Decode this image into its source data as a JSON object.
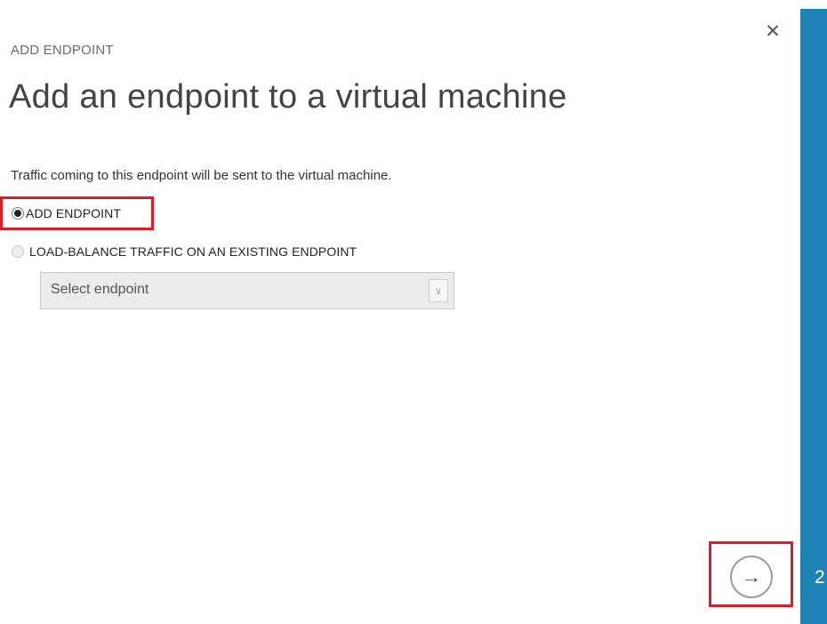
{
  "dialog": {
    "subtitle": "ADD ENDPOINT",
    "title": "Add an endpoint to a virtual machine",
    "description": "Traffic coming to this endpoint will be sent to the virtual machine.",
    "options": {
      "add_endpoint": {
        "label": "ADD ENDPOINT",
        "selected": true
      },
      "load_balance": {
        "label": "LOAD-BALANCE TRAFFIC ON AN EXISTING ENDPOINT",
        "selected": false
      }
    },
    "endpoint_select": {
      "placeholder": "Select endpoint"
    },
    "close_icon": "close-icon",
    "next_icon": "arrow-right-icon"
  },
  "side_panel": {
    "step_number": "2",
    "color": "#1f82b4"
  },
  "highlight_color": "#e01c2b"
}
